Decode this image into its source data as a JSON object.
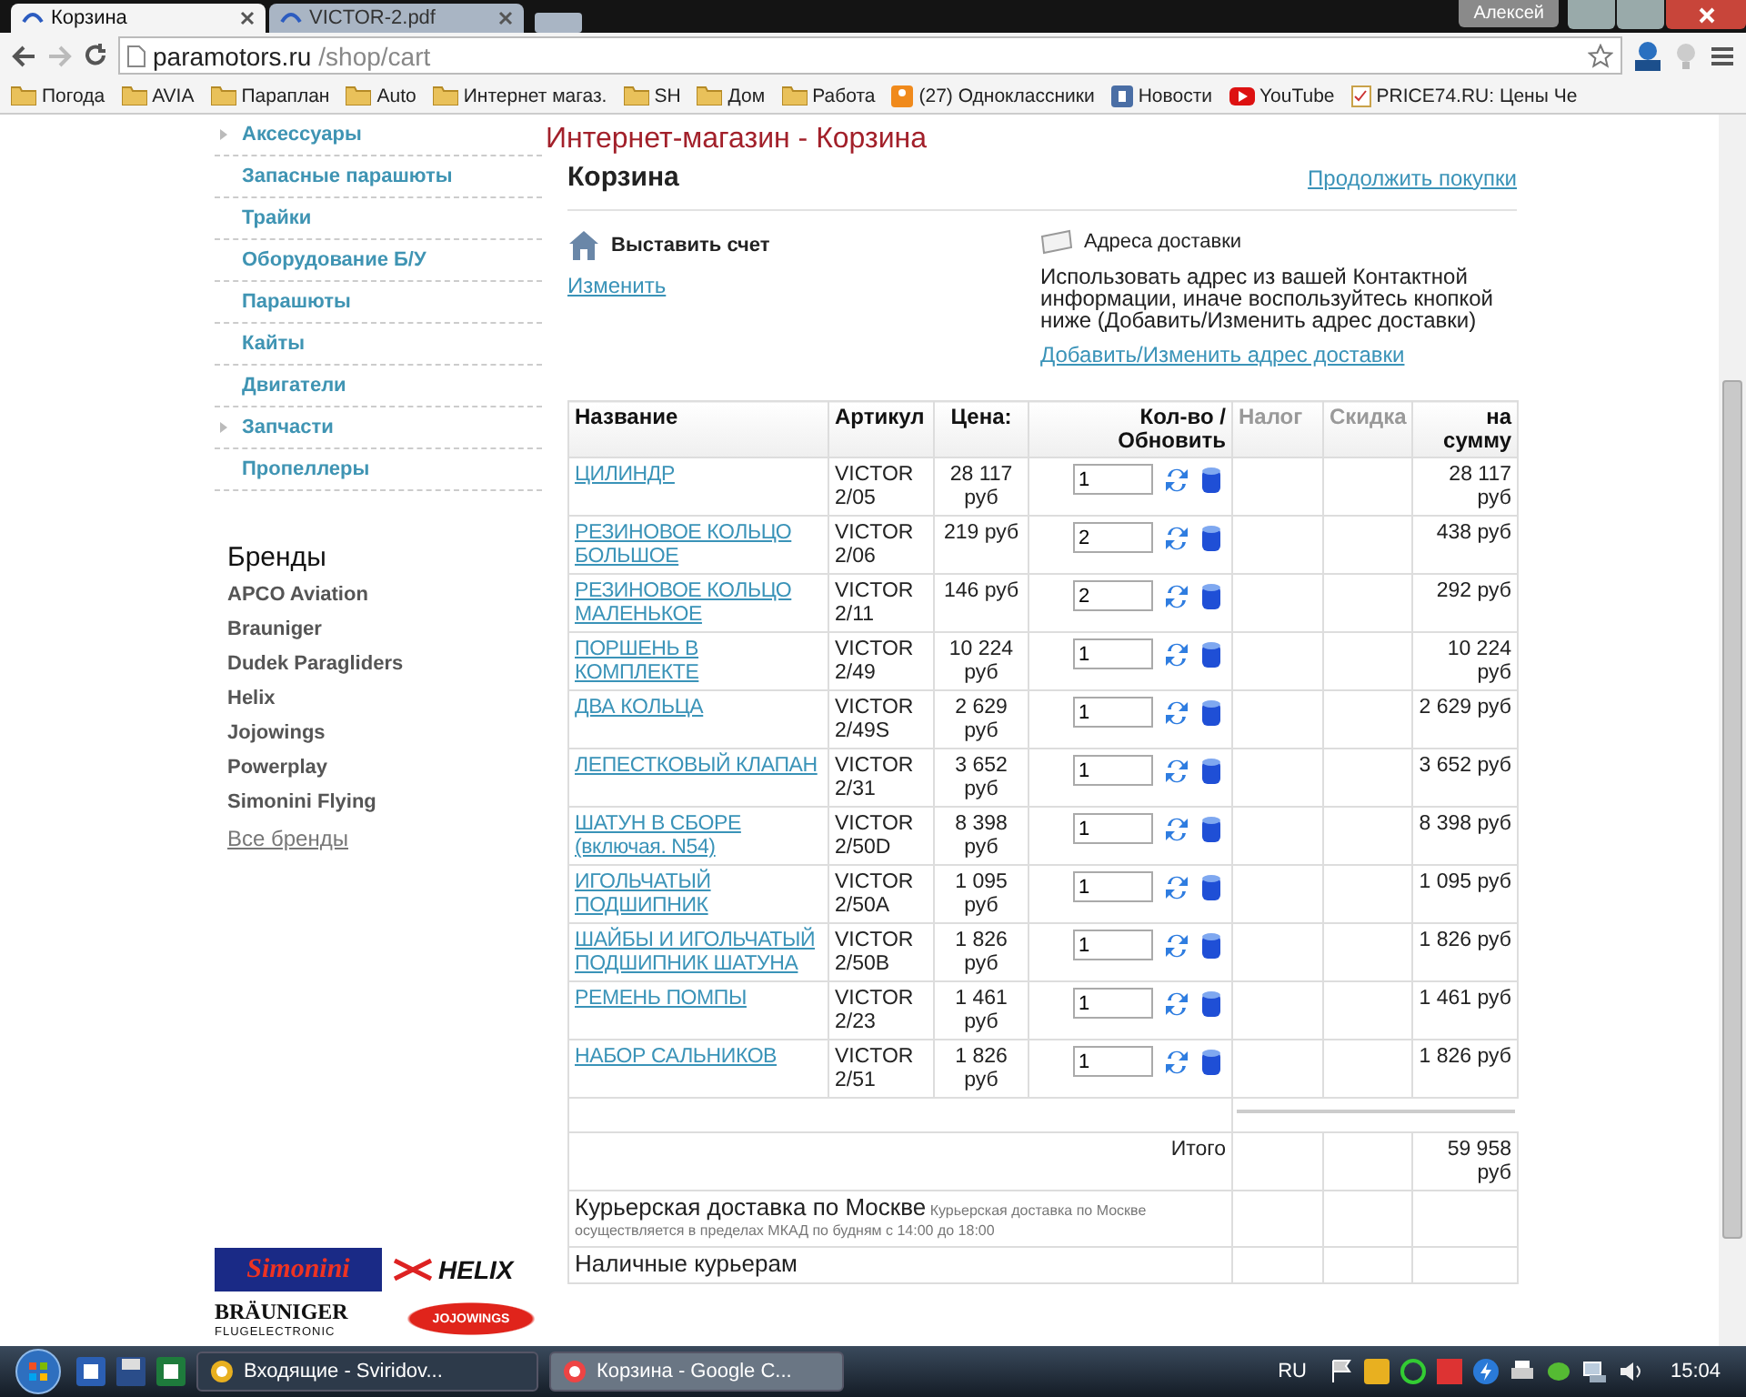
{
  "browser": {
    "tabs": [
      {
        "title": "Корзина",
        "selected": true
      },
      {
        "title": "VICTOR-2.pdf",
        "selected": false
      }
    ],
    "user": "Алексей",
    "address": {
      "host": "paramotors.ru",
      "path": "/shop/cart"
    },
    "bookmarks": [
      {
        "label": "Погода",
        "kind": "folder"
      },
      {
        "label": "AVIA",
        "kind": "folder"
      },
      {
        "label": "Параплан",
        "kind": "folder"
      },
      {
        "label": "Auto",
        "kind": "folder"
      },
      {
        "label": "Интернет магаз.",
        "kind": "folder"
      },
      {
        "label": "SH",
        "kind": "folder"
      },
      {
        "label": "Дом",
        "kind": "folder"
      },
      {
        "label": "Работа",
        "kind": "folder"
      },
      {
        "label": "(27) Одноклассники",
        "kind": "ok"
      },
      {
        "label": "Новости",
        "kind": "vk"
      },
      {
        "label": "YouTube",
        "kind": "youtube"
      },
      {
        "label": "PRICE74.RU: Цены Че",
        "kind": "page"
      }
    ]
  },
  "sidebar": {
    "categories": [
      {
        "label": "Аксессуары",
        "has_submenu": true
      },
      {
        "label": "Запасные парашюты",
        "has_submenu": false
      },
      {
        "label": "Трайки",
        "has_submenu": false
      },
      {
        "label": "Оборудование Б/У",
        "has_submenu": false
      },
      {
        "label": "Парашюты",
        "has_submenu": false
      },
      {
        "label": "Кайты",
        "has_submenu": false
      },
      {
        "label": "Двигатели",
        "has_submenu": false
      },
      {
        "label": "Запчасти",
        "has_submenu": true
      },
      {
        "label": "Пропеллеры",
        "has_submenu": false
      }
    ],
    "brands_title": "Бренды",
    "brands": [
      "APCO Aviation",
      "Brauniger",
      "Dudek Paragliders",
      "Helix",
      "Jojowings",
      "Powerplay",
      "Simonini Flying"
    ],
    "all_brands": "Все бренды",
    "logos": [
      {
        "kind": "simonini",
        "text": "Simonini"
      },
      {
        "kind": "helix",
        "text": "HELIX"
      },
      {
        "kind": "brauniger",
        "text": "BRÄUNIGER",
        "subtext": "FLUGELECTRONIC"
      },
      {
        "kind": "jojo",
        "text": "JOJOWINGS"
      }
    ]
  },
  "page": {
    "site_title": "Интернет-магазин - Корзина",
    "heading": "Корзина",
    "continue_link": "Продолжить покупки",
    "billing": {
      "title": "Выставить счет",
      "link": "Изменить"
    },
    "shipping": {
      "title": "Адреса доставки",
      "text": "Использовать адрес из вашей Контактной информации, иначе воспользуйтесь кнопкой ниже (Добавить/Изменить адрес доставки)",
      "link": "Добавить/Изменить адрес доставки"
    }
  },
  "cart": {
    "columns": [
      {
        "label": "Название",
        "disabled": false
      },
      {
        "label": "Артикул",
        "disabled": false
      },
      {
        "label": "Цена:",
        "disabled": false
      },
      {
        "label": "Кол-во / Обновить",
        "disabled": false
      },
      {
        "label": "Налог",
        "disabled": true
      },
      {
        "label": "Скидка",
        "disabled": true
      },
      {
        "label": "на сумму",
        "disabled": false
      }
    ],
    "rows": [
      {
        "name": "ЦИЛИНДР",
        "sku": "VICTOR 2/05",
        "price": "28 117 руб",
        "qty": "1",
        "total": "28 117 руб"
      },
      {
        "name": "РЕЗИНОВОЕ КОЛЬЦО БОЛЬШОЕ",
        "sku": "VICTOR 2/06",
        "price": "219 руб",
        "qty": "2",
        "total": "438 руб"
      },
      {
        "name": "РЕЗИНОВОЕ КОЛЬЦО МАЛЕНЬКОЕ",
        "sku": "VICTOR 2/11",
        "price": "146 руб",
        "qty": "2",
        "total": "292 руб"
      },
      {
        "name": "ПОРШЕНЬ В КОМПЛЕКТЕ",
        "sku": "VICTOR 2/49",
        "price": "10 224 руб",
        "qty": "1",
        "total": "10 224 руб"
      },
      {
        "name": "ДВА КОЛЬЦА",
        "sku": "VICTOR 2/49S",
        "price": "2 629 руб",
        "qty": "1",
        "total": "2 629 руб"
      },
      {
        "name": "ЛЕПЕСТКОВЫЙ КЛАПАН",
        "sku": "VICTOR 2/31",
        "price": "3 652 руб",
        "qty": "1",
        "total": "3 652 руб"
      },
      {
        "name": "ШАТУН В СБОРЕ (включая. N54)",
        "sku": "VICTOR 2/50D",
        "price": "8 398 руб",
        "qty": "1",
        "total": "8 398 руб"
      },
      {
        "name": "ИГОЛЬЧАТЫЙ ПОДШИПНИК",
        "sku": "VICTOR 2/50A",
        "price": "1 095 руб",
        "qty": "1",
        "total": "1 095 руб"
      },
      {
        "name": "ШАЙБЫ И ИГОЛЬЧАТЫЙ ПОДШИПНИК ШАТУНА",
        "sku": "VICTOR 2/50B",
        "price": "1 826 руб",
        "qty": "1",
        "total": "1 826 руб"
      },
      {
        "name": "РЕМЕНЬ ПОМПЫ",
        "sku": "VICTOR 2/23",
        "price": "1 461 руб",
        "qty": "1",
        "total": "1 461 руб"
      },
      {
        "name": "НАБОР САЛЬНИКОВ",
        "sku": "VICTOR 2/51",
        "price": "1 826 руб",
        "qty": "1",
        "total": "1 826 руб"
      }
    ],
    "total_label": "Итого",
    "total_value": "59 958 руб",
    "delivery": [
      {
        "title": "Курьерская доставка по Москве",
        "note": "Курьерская доставка по Москве осуществляется в пределах МКАД по будням с 14:00 до 18:00"
      },
      {
        "title": "Наличные курьерам"
      }
    ]
  },
  "taskbar": {
    "tasks": [
      {
        "label": "Входящие - Sviridov...",
        "selected": false
      },
      {
        "label": "Корзина - Google C...",
        "selected": true
      }
    ],
    "language": "RU",
    "time": "15:04"
  }
}
